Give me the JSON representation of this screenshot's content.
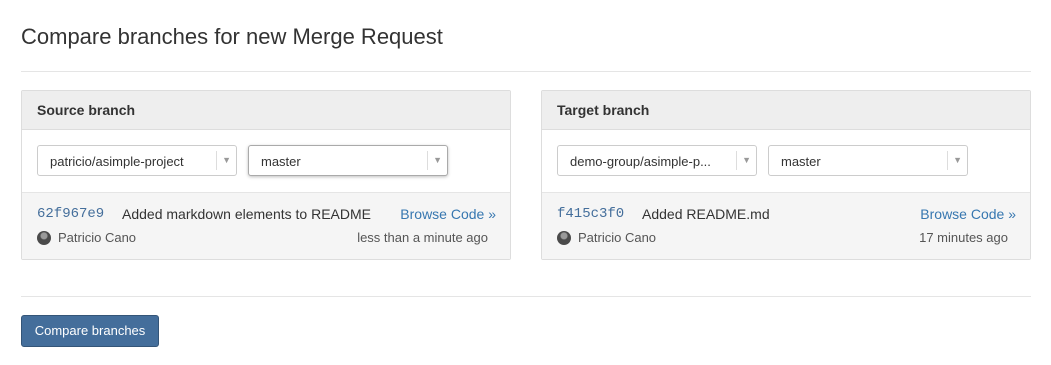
{
  "page": {
    "title": "Compare branches for new Merge Request"
  },
  "source": {
    "heading": "Source branch",
    "project": "patricio/asimple-project",
    "branch": "master",
    "commit": {
      "sha": "62f967e9",
      "message": "Added markdown elements to README",
      "author": "Patricio Cano",
      "time": "less than a minute ago",
      "browse_label": "Browse Code »"
    }
  },
  "target": {
    "heading": "Target branch",
    "project": "demo-group/asimple-p...",
    "branch": "master",
    "commit": {
      "sha": "f415c3f0",
      "message": "Added README.md",
      "author": "Patricio Cano",
      "time": "17 minutes ago",
      "browse_label": "Browse Code »"
    }
  },
  "actions": {
    "compare_label": "Compare branches"
  },
  "icons": {
    "dropdown": "chevron-down-icon",
    "avatar": "user-avatar"
  },
  "colors": {
    "link": "#3777b0",
    "sha": "#446e9b",
    "button": "#446e9b"
  }
}
